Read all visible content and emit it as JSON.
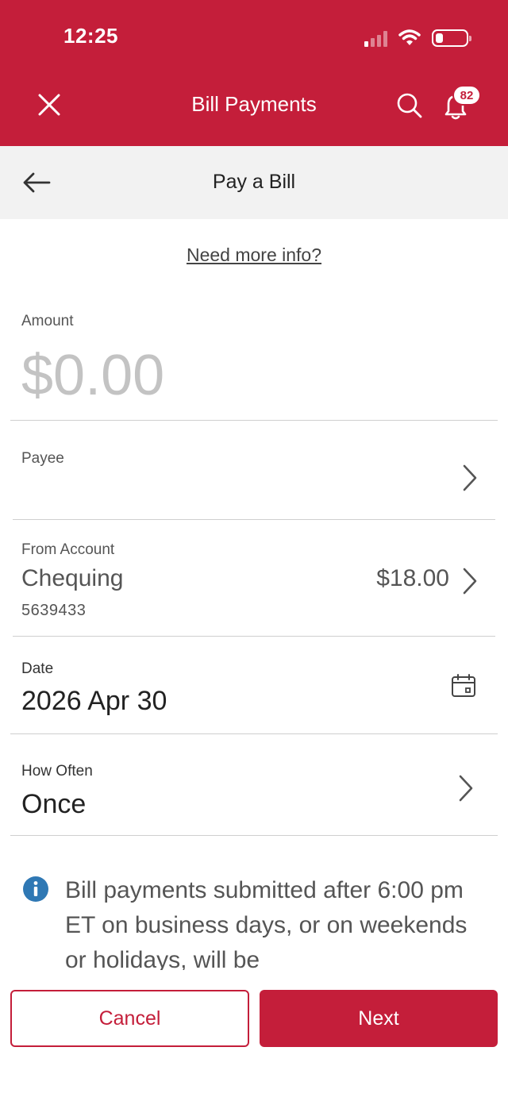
{
  "status_bar": {
    "time": "12:25",
    "icons": [
      "signal-icon",
      "wifi-icon",
      "battery-icon"
    ]
  },
  "header": {
    "title": "Bill Payments",
    "close_icon": "close-icon",
    "search_icon": "search-icon",
    "bell_icon": "bell-icon",
    "notification_count": "82"
  },
  "subheader": {
    "title": "Pay a Bill",
    "back_icon": "arrow-left-icon"
  },
  "info_link": "Need more info?",
  "form": {
    "amount": {
      "label": "Amount",
      "value": "$0.00"
    },
    "payee": {
      "label": "Payee",
      "value": ""
    },
    "from_account": {
      "label": "From Account",
      "name": "Chequing",
      "number": "5639433",
      "balance": "$18.00"
    },
    "date": {
      "label": "Date",
      "value": "2026 Apr 30"
    },
    "how_often": {
      "label": "How Often",
      "value": "Once"
    }
  },
  "notice": {
    "icon": "info-icon",
    "text": "Bill payments submitted after 6:00 pm ET on business days, or on weekends or holidays, will be"
  },
  "actions": {
    "cancel_label": "Cancel",
    "next_label": "Next"
  },
  "colors": {
    "brand": "#c41e3a",
    "subheader_bg": "#f2f2f2",
    "info_blue": "#2f78b4"
  }
}
